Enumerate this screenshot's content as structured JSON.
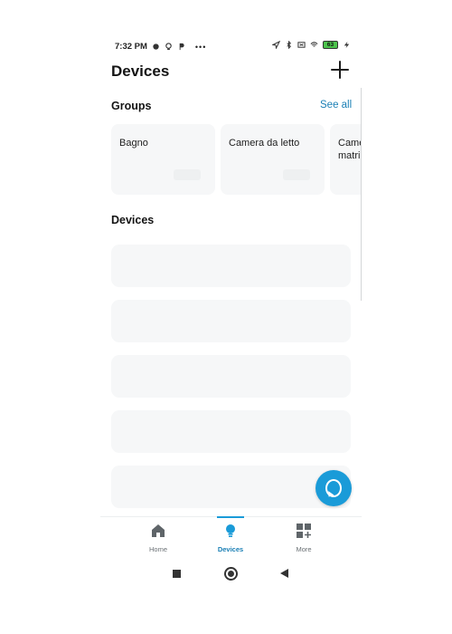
{
  "status_bar": {
    "time": "7:32 PM",
    "battery": "63",
    "more": "•••"
  },
  "header": {
    "title": "Devices",
    "add_icon": "plus-icon"
  },
  "groups_section": {
    "title": "Groups",
    "see_all": "See all",
    "items": [
      {
        "label": "Bagno"
      },
      {
        "label": "Camera da letto"
      },
      {
        "label": "Camera matrimoniale"
      }
    ]
  },
  "devices_section": {
    "title": "Devices",
    "placeholder_count": 5
  },
  "assistant_button": {
    "icon": "alexa-icon"
  },
  "bottom_nav": {
    "items": [
      {
        "label": "Home",
        "icon": "home-icon",
        "active": false
      },
      {
        "label": "Devices",
        "icon": "lightbulb-icon",
        "active": true
      },
      {
        "label": "More",
        "icon": "grid-plus-icon",
        "active": false
      }
    ]
  },
  "colors": {
    "accent": "#1a9bd8",
    "link": "#1a7fb5",
    "card": "#f6f7f8",
    "text": "#141414"
  }
}
